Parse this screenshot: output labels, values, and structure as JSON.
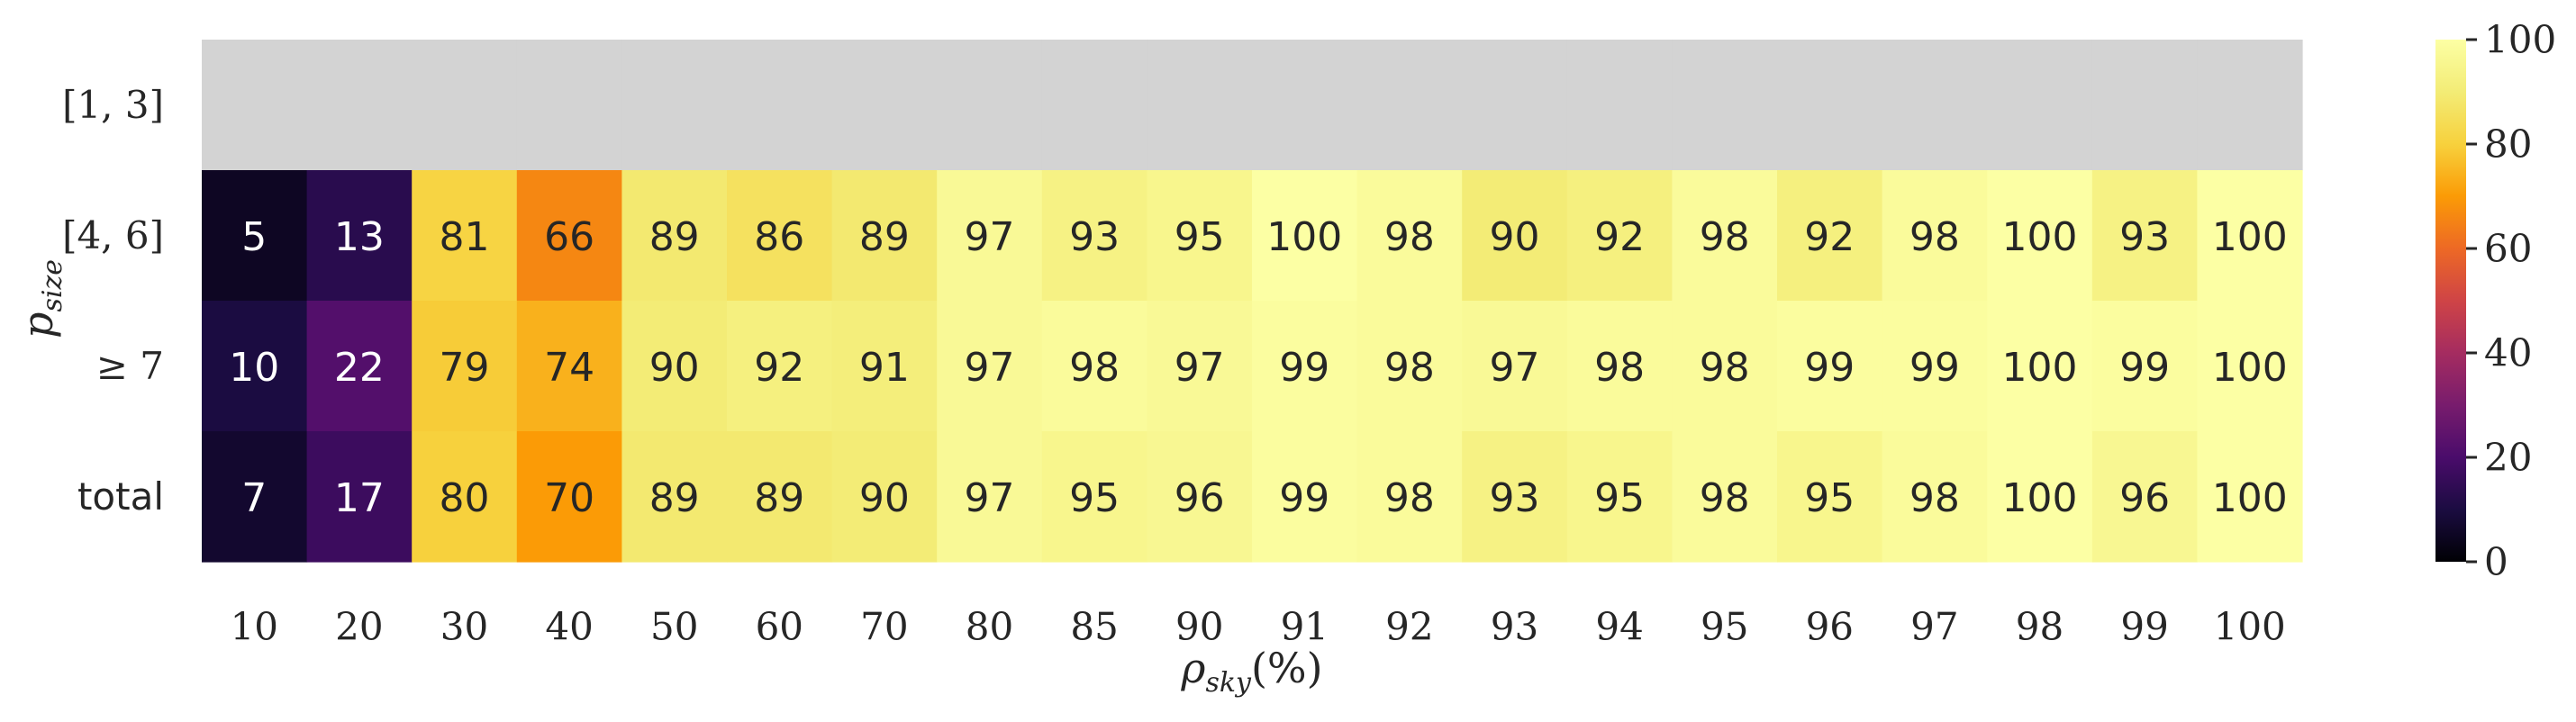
{
  "chart_data": {
    "type": "heatmap",
    "xlabel": "ρsky(%)",
    "ylabel": "psize",
    "x_categories": [
      "10",
      "20",
      "30",
      "40",
      "50",
      "60",
      "70",
      "80",
      "85",
      "90",
      "91",
      "92",
      "93",
      "94",
      "95",
      "96",
      "97",
      "98",
      "99",
      "100"
    ],
    "y_categories": [
      "[1, 3]",
      "[4, 6]",
      "≥ 7",
      "total"
    ],
    "values": [
      [
        null,
        null,
        null,
        null,
        null,
        null,
        null,
        null,
        null,
        null,
        null,
        null,
        null,
        null,
        null,
        null,
        null,
        null,
        null,
        null
      ],
      [
        5,
        13,
        81,
        66,
        89,
        86,
        89,
        97,
        93,
        95,
        100,
        98,
        90,
        92,
        98,
        92,
        98,
        100,
        93,
        100
      ],
      [
        10,
        22,
        79,
        74,
        90,
        92,
        91,
        97,
        98,
        97,
        99,
        98,
        97,
        98,
        98,
        99,
        99,
        100,
        99,
        100
      ],
      [
        7,
        17,
        80,
        70,
        89,
        89,
        90,
        97,
        95,
        96,
        99,
        98,
        93,
        95,
        98,
        95,
        98,
        100,
        96,
        100
      ]
    ],
    "missing_color": "#d3d3d3",
    "colormap": "inferno",
    "colorbar": {
      "range": [
        0,
        100
      ],
      "ticks": [
        "0",
        "20",
        "40",
        "60",
        "80",
        "100"
      ]
    }
  }
}
